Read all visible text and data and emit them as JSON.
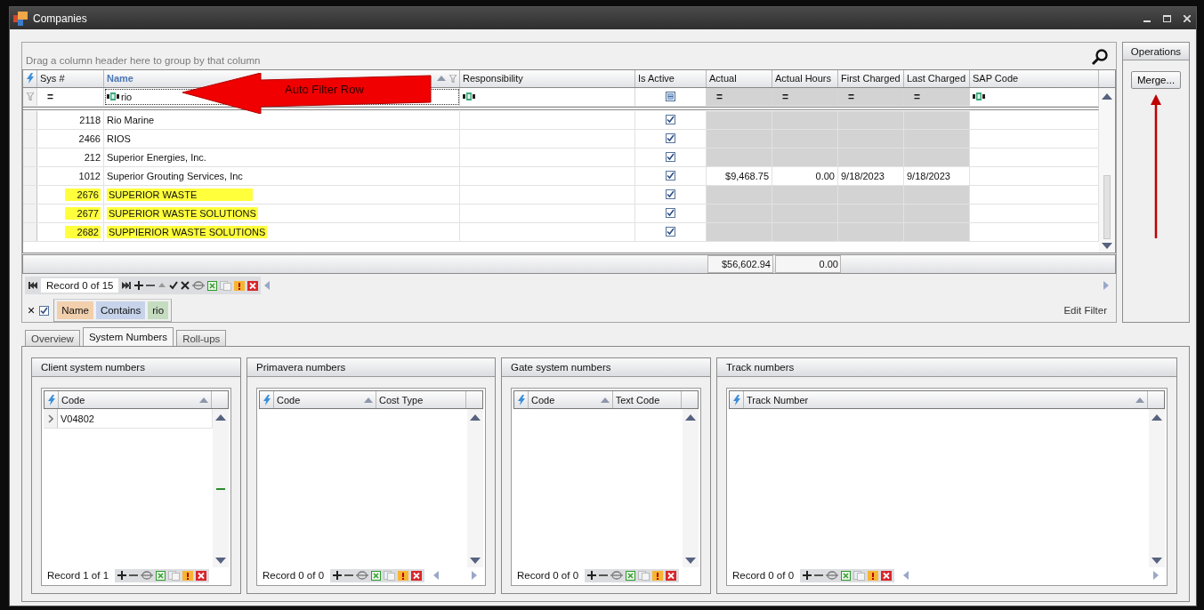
{
  "window": {
    "title": "Companies"
  },
  "grid": {
    "group_panel": "Drag a column header here to group by that column",
    "columns": [
      {
        "label": "Sys #",
        "sorted": false,
        "filtered": false
      },
      {
        "label": "Name",
        "sorted": true,
        "filtered": true
      },
      {
        "label": "Responsibility",
        "sorted": false,
        "filtered": false
      },
      {
        "label": "Is Active",
        "sorted": false,
        "filtered": false
      },
      {
        "label": "Actual",
        "sorted": false,
        "filtered": false
      },
      {
        "label": "Actual Hours",
        "sorted": false,
        "filtered": false
      },
      {
        "label": "First Charged",
        "sorted": false,
        "filtered": false
      },
      {
        "label": "Last Charged",
        "sorted": false,
        "filtered": false
      },
      {
        "label": "SAP Code",
        "sorted": false,
        "filtered": false
      }
    ],
    "filter_row": [
      {
        "kind": "operator",
        "text": "=",
        "disabled": false
      },
      {
        "kind": "text",
        "value": "rio",
        "disabled": false
      },
      {
        "kind": "text",
        "disabled": false
      },
      {
        "kind": "checkbox",
        "disabled": false
      },
      {
        "kind": "operator",
        "text": "=",
        "disabled": true
      },
      {
        "kind": "operator",
        "text": "=",
        "disabled": true
      },
      {
        "kind": "operator",
        "text": "=",
        "disabled": true
      },
      {
        "kind": "operator",
        "text": "=",
        "disabled": true
      },
      {
        "kind": "text",
        "disabled": false
      }
    ],
    "rows": [
      {
        "sys": "2118",
        "name": "Rio Marine",
        "highlighted": false,
        "active": true
      },
      {
        "sys": "2466",
        "name": "RIOS",
        "highlighted": false,
        "active": true
      },
      {
        "sys": "212",
        "name": "Superior Energies, Inc.",
        "highlighted": false,
        "active": true
      },
      {
        "sys": "1012",
        "name": "Superior Grouting Services, Inc",
        "highlighted": false,
        "active": true,
        "actual": "$9,468.75",
        "actual_hours": "0.00",
        "first_charged": "9/18/2023",
        "last_charged": "9/18/2023"
      },
      {
        "sys": "2676",
        "name": "SUPERIOR WASTE",
        "highlighted": true,
        "active": true
      },
      {
        "sys": "2677",
        "name": "SUPERIOR WASTE SOLUTIONS",
        "highlighted": true,
        "active": true
      },
      {
        "sys": "2682",
        "name": "SUPPIERIOR WASTE SOLUTIONS",
        "highlighted": true,
        "active": true
      }
    ],
    "totals": {
      "actual": "$56,602.94",
      "actual_hours": "0.00"
    },
    "navigator": {
      "record": "Record 0 of 15"
    },
    "filter": {
      "close": "×",
      "enabled": true,
      "tokens": [
        {
          "text": "Name",
          "color": "#f2cfad"
        },
        {
          "text": "Contains",
          "color": "#c6d3ea"
        },
        {
          "text": "rio",
          "color": "#c5dcc0"
        }
      ],
      "edit": "Edit Filter"
    }
  },
  "annotation": {
    "text": "Auto Filter Row"
  },
  "operations": {
    "title": "Operations",
    "buttons": [
      "Merge..."
    ]
  },
  "tabs": [
    {
      "label": "Overview",
      "selected": false
    },
    {
      "label": "System Numbers",
      "selected": true
    },
    {
      "label": "Roll-ups",
      "selected": false
    }
  ],
  "groups": [
    {
      "title": "Client system numbers",
      "columns": [
        {
          "label": "Code",
          "sorted": true
        }
      ],
      "rows": [
        {
          "cells": [
            "V04802"
          ],
          "current": true
        }
      ],
      "record": "Record 1 of 1",
      "horizontal_scroll": false
    },
    {
      "title": "Primavera numbers",
      "columns": [
        {
          "label": "Code",
          "sorted": true
        },
        {
          "label": "Cost Type",
          "sorted": false
        }
      ],
      "record": "Record 0 of 0",
      "horizontal_scroll": true
    },
    {
      "title": "Gate system numbers",
      "columns": [
        {
          "label": "Code",
          "sorted": true
        },
        {
          "label": "Text Code",
          "sorted": false
        }
      ],
      "record": "Record 0 of 0",
      "horizontal_scroll": false
    },
    {
      "title": "Track numbers",
      "columns": [
        {
          "label": "Track Number",
          "sorted": true
        }
      ],
      "record": "Record 0 of 0",
      "horizontal_scroll": true
    }
  ]
}
